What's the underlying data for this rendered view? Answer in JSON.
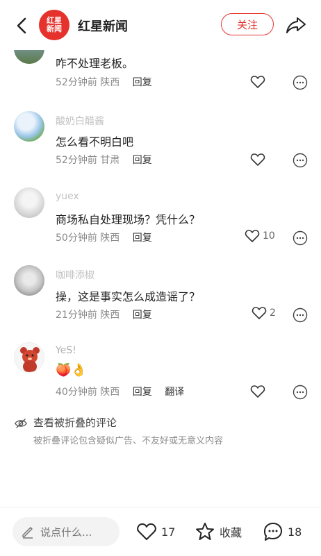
{
  "header": {
    "back_icon": "chevron-left-icon",
    "logo_line1": "红星",
    "logo_line2": "新闻",
    "title": "红星新闻",
    "follow_label": "关注",
    "share_icon": "share-icon",
    "brand_color": "#e5322d"
  },
  "comments": [
    {
      "name": "",
      "text": "咋不处理老板。",
      "time": "52分钟前",
      "region": "陕西",
      "reply": "回复",
      "likes": ""
    },
    {
      "name": "酸奶白醋酱",
      "text": "怎么看不明白吧",
      "time": "52分钟前",
      "region": "甘肃",
      "reply": "回复",
      "likes": ""
    },
    {
      "name": "yuex",
      "text": "商场私自处理现场？凭什么？",
      "time": "50分钟前",
      "region": "陕西",
      "reply": "回复",
      "likes": "10"
    },
    {
      "name": "咖啡添椒",
      "text": "操，这是事实怎么成造谣了？",
      "time": "21分钟前",
      "region": "陕西",
      "reply": "回复",
      "likes": "2"
    },
    {
      "name": "YeS!",
      "text": "🍑👌",
      "time": "40分钟前",
      "region": "陕西",
      "reply": "回复",
      "translate": "翻译",
      "likes": ""
    }
  ],
  "folded": {
    "title": "查看被折叠的评论",
    "subtitle": "被折叠评论包含疑似广告、不友好或无意义内容"
  },
  "bottom": {
    "input_placeholder": "说点什么...",
    "likes": "17",
    "favorite_label": "收藏",
    "comments": "18"
  }
}
